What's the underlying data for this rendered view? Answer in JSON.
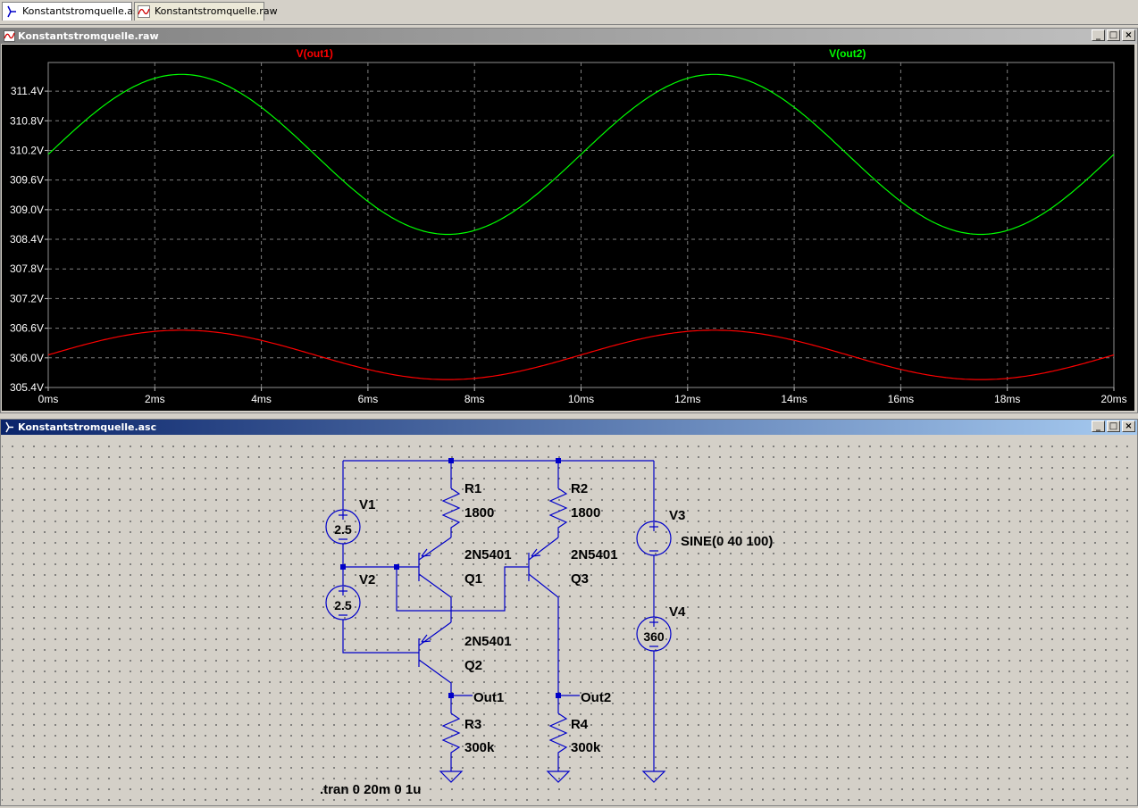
{
  "tabs": [
    {
      "label": "Konstantstromquelle.asc",
      "icon": "schematic-icon"
    },
    {
      "label": "Konstantstromquelle.raw",
      "icon": "waveform-icon"
    }
  ],
  "waveform_window": {
    "title": "Konstantstromquelle.raw",
    "buttons": {
      "minimize": "_",
      "maximize": "□",
      "close": "×"
    }
  },
  "schematic_window": {
    "title": "Konstantstromquelle.asc",
    "buttons": {
      "minimize": "_",
      "maximize": "□",
      "close": "×"
    }
  },
  "colors": {
    "trace_out1": "#ff0000",
    "trace_out2": "#00ff00",
    "plot_bg": "#000000",
    "wire": "#0000c8",
    "grid": "#808080"
  },
  "chart_data": {
    "type": "line",
    "xlabel": "",
    "ylabel": "",
    "xlim": [
      0,
      20
    ],
    "ylim": [
      305.4,
      311.98
    ],
    "x_ticks": [
      "0ms",
      "2ms",
      "4ms",
      "6ms",
      "8ms",
      "10ms",
      "12ms",
      "14ms",
      "16ms",
      "18ms",
      "20ms"
    ],
    "y_ticks": [
      "311.4V",
      "310.8V",
      "310.2V",
      "309.6V",
      "309.0V",
      "308.4V",
      "307.8V",
      "307.2V",
      "306.6V",
      "306.0V",
      "305.4V"
    ],
    "grid": true,
    "series": [
      {
        "name": "V(out1)",
        "color": "#ff0000",
        "offset_V": 306.06,
        "amplitude_V": 0.5,
        "frequency_Hz": 100
      },
      {
        "name": "V(out2)",
        "color": "#00ff00",
        "offset_V": 310.12,
        "amplitude_V": 1.62,
        "frequency_Hz": 100
      }
    ]
  },
  "schematic": {
    "components": {
      "V1": {
        "name": "V1",
        "value": "2.5"
      },
      "V2": {
        "name": "V2",
        "value": "2.5"
      },
      "V3": {
        "name": "V3",
        "value": "SINE(0 40 100)"
      },
      "V4": {
        "name": "V4",
        "value": "360"
      },
      "R1": {
        "name": "R1",
        "value": "1800"
      },
      "R2": {
        "name": "R2",
        "value": "1800"
      },
      "R3": {
        "name": "R3",
        "value": "300k"
      },
      "R4": {
        "name": "R4",
        "value": "300k"
      },
      "Q1": {
        "name": "Q1",
        "value": "2N5401"
      },
      "Q2": {
        "name": "Q2",
        "value": "2N5401"
      },
      "Q3": {
        "name": "Q3",
        "value": "2N5401"
      }
    },
    "net_labels": {
      "out1": "Out1",
      "out2": "Out2"
    },
    "directive": ".tran 0 20m 0 1u"
  }
}
